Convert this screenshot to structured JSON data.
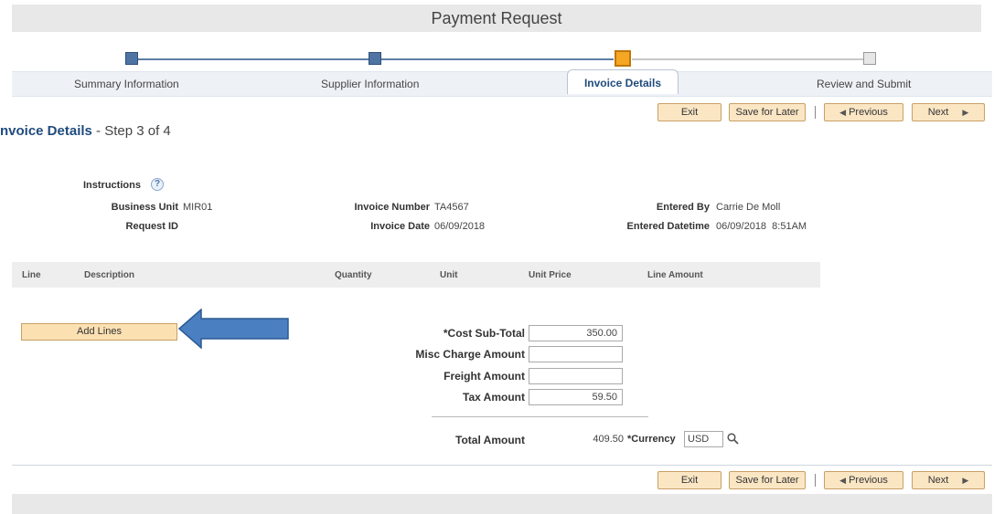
{
  "header": {
    "title": "Payment Request"
  },
  "train": {
    "steps": [
      {
        "label": "Summary Information"
      },
      {
        "label": "Supplier Information"
      },
      {
        "label": "Invoice Details"
      },
      {
        "label": "Review and Submit"
      }
    ],
    "current_step": 3
  },
  "toolbar": {
    "exit": "Exit",
    "save_for_later": "Save for Later",
    "previous": "Previous",
    "next": "Next",
    "separator": "|"
  },
  "page": {
    "heading": "nvoice Details",
    "step_text": " - Step 3 of 4"
  },
  "info": {
    "instructions_label": "Instructions",
    "help_icon_glyph": "?",
    "business_unit_label": "Business Unit",
    "business_unit": "MIR01",
    "request_id_label": "Request ID",
    "request_id": "",
    "invoice_number_label": "Invoice Number",
    "invoice_number": "TA4567",
    "invoice_date_label": "Invoice Date",
    "invoice_date": "06/09/2018",
    "entered_by_label": "Entered By",
    "entered_by": "Carrie De Moll",
    "entered_datetime_label": "Entered Datetime",
    "entered_datetime": "06/09/2018  8:51AM"
  },
  "grid": {
    "columns": [
      "Line",
      "Description",
      "Quantity",
      "Unit",
      "Unit Price",
      "Line Amount"
    ],
    "rows": []
  },
  "add_lines": "Add Lines",
  "totals": {
    "cost_subtotal_label": "*Cost Sub-Total",
    "cost_subtotal": "350.00",
    "misc_charge_label": "Misc Charge Amount",
    "misc_charge": "",
    "freight_label": "Freight Amount",
    "freight": "",
    "tax_label": "Tax Amount",
    "tax": "59.50",
    "total_label": "Total Amount",
    "total": "409.50",
    "currency_label": "*Currency",
    "currency": "USD"
  },
  "colors": {
    "accent": "#1f4b7c",
    "button_bg": "#fbe6c4",
    "current_step": "#f5a623",
    "completed_step": "#4f74a3",
    "annotation_arrow": "#4a7fc1"
  },
  "icons": {
    "help": "help-icon",
    "lookup": "search-icon",
    "previous": "triangle-left-icon",
    "next": "triangle-right-icon",
    "annotation": "arrow-left-icon"
  }
}
